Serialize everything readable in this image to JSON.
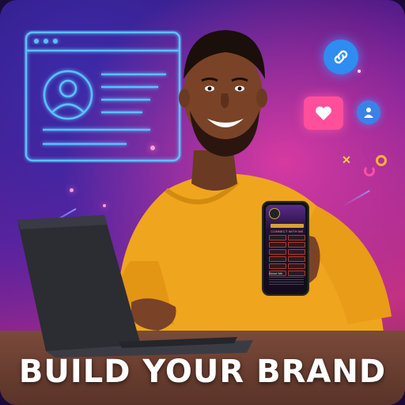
{
  "headline": "BUILD YOUR BRAND",
  "phone": {
    "tagline": "CONNECT WITH ME",
    "name": "About Me"
  },
  "colors": {
    "brand_pink": "#ff4f9a",
    "link_blue": "#2f8cf0",
    "sweater": "#f0a51e",
    "neon_frame": "#4fb6ff"
  },
  "icons": [
    "profile-window-icon",
    "link-icon",
    "heart-icon",
    "user-icon",
    "laptop-icon",
    "phone-icon"
  ]
}
